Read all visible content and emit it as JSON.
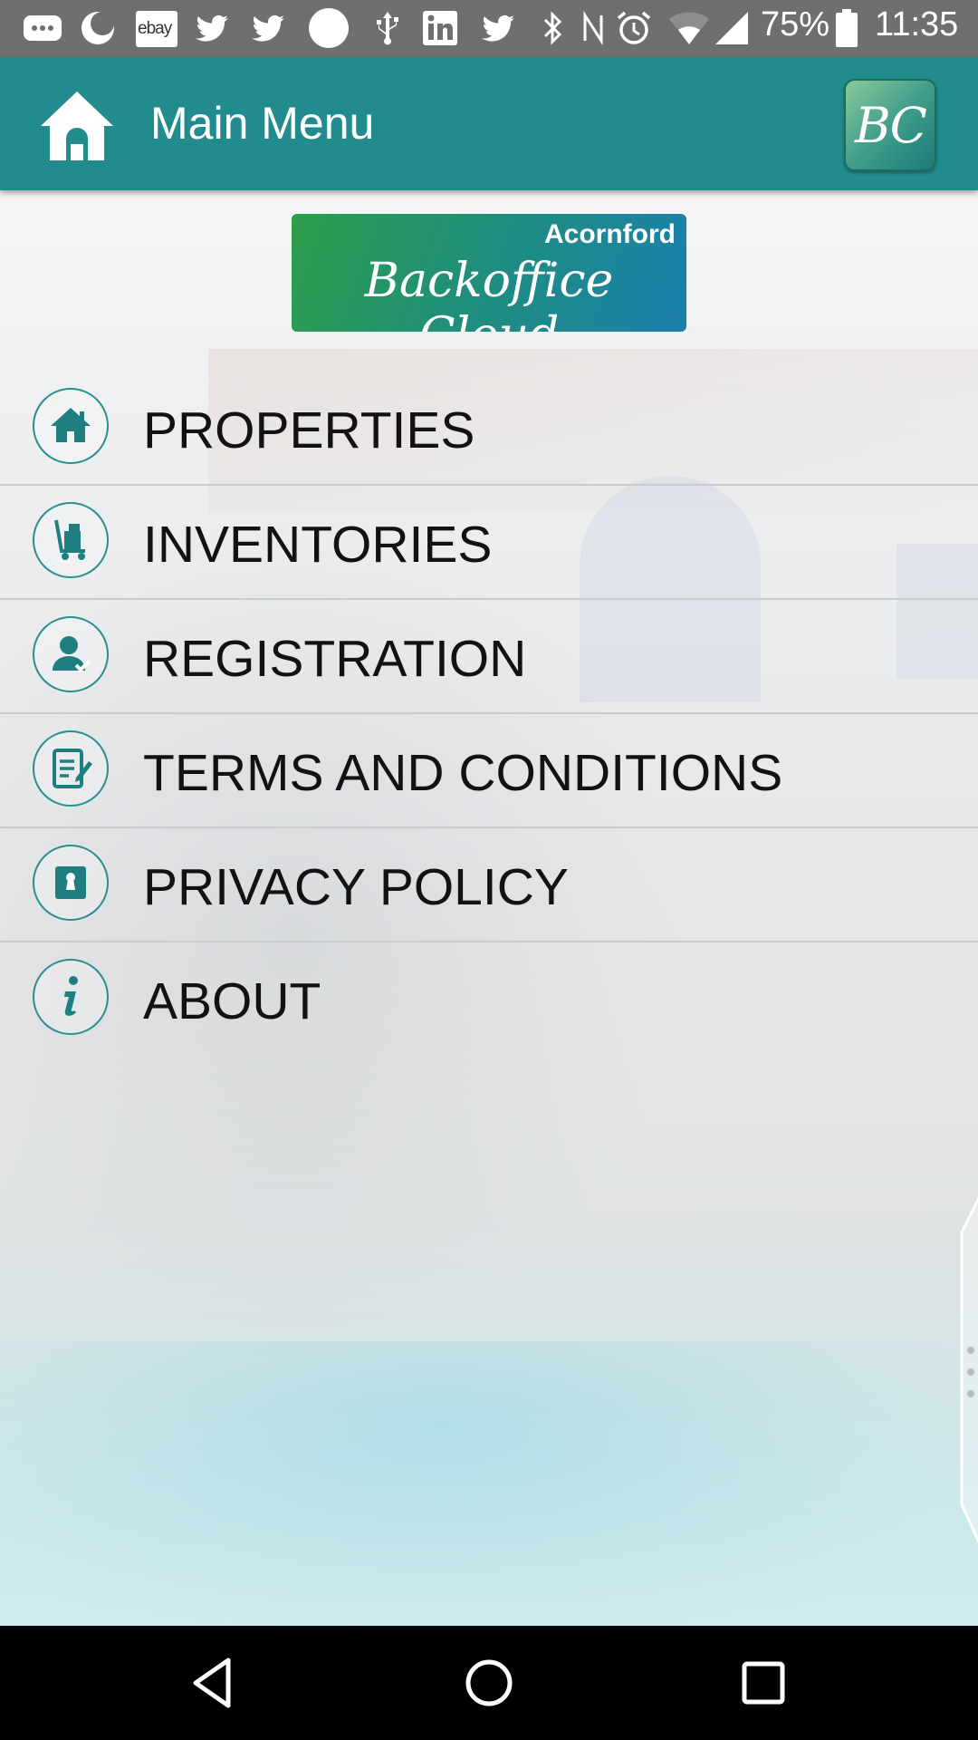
{
  "status_bar": {
    "battery": "75%",
    "time": "11:35",
    "icons": [
      "messages-icon",
      "moon-icon",
      "ebay-icon",
      "twitter-icon",
      "twitter-icon",
      "circle-icon",
      "usb-icon",
      "linkedin-icon",
      "twitter-icon",
      "bluetooth-icon",
      "nfc-icon",
      "alarm-icon",
      "wifi-icon",
      "signal-icon",
      "battery-icon"
    ],
    "ebay_label": "ebay"
  },
  "app_bar": {
    "title": "Main Menu",
    "bc_label": "BC",
    "color": "#228b8d"
  },
  "logo": {
    "brand": "Acornford",
    "title": "Backoffice Cloud"
  },
  "menu": {
    "items": [
      {
        "label": "PROPERTIES",
        "icon": "house-icon"
      },
      {
        "label": "INVENTORIES",
        "icon": "luggage-cart-icon"
      },
      {
        "label": "REGISTRATION",
        "icon": "user-check-icon"
      },
      {
        "label": "TERMS AND CONDITIONS",
        "icon": "document-edit-icon"
      },
      {
        "label": "PRIVACY POLICY",
        "icon": "keyhole-icon"
      },
      {
        "label": "ABOUT",
        "icon": "info-icon"
      }
    ]
  },
  "nav_bar": {
    "buttons": [
      "back-icon",
      "home-circle-icon",
      "recents-icon"
    ]
  }
}
